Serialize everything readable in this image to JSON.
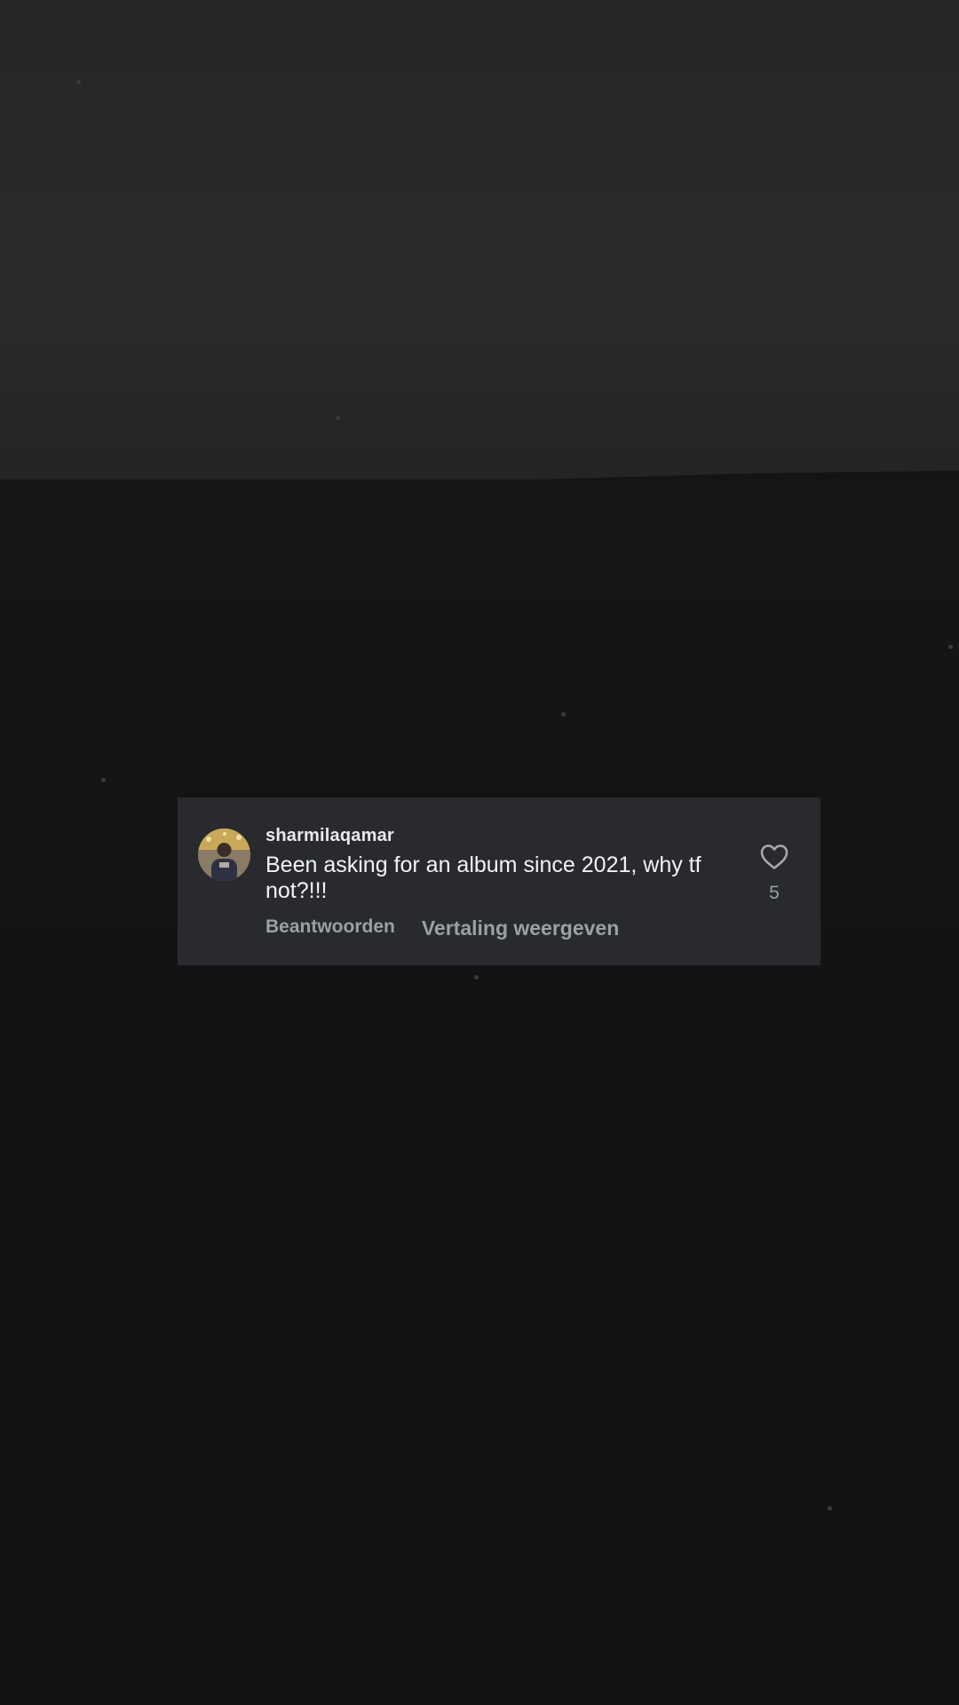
{
  "comment": {
    "username": "sharmilaqamar",
    "text": "Been asking for an album since 2021, why tf not?!!!",
    "reply_label": "Beantwoorden",
    "translate_label": "Vertaling weergeven",
    "like_count": "5",
    "avatar_icon": "user-avatar",
    "like_icon": "heart-outline-icon"
  },
  "colors": {
    "background": "#141414",
    "card": "#282a2e",
    "text_primary": "#f2f3f5",
    "text_secondary": "#9c9fa6"
  }
}
